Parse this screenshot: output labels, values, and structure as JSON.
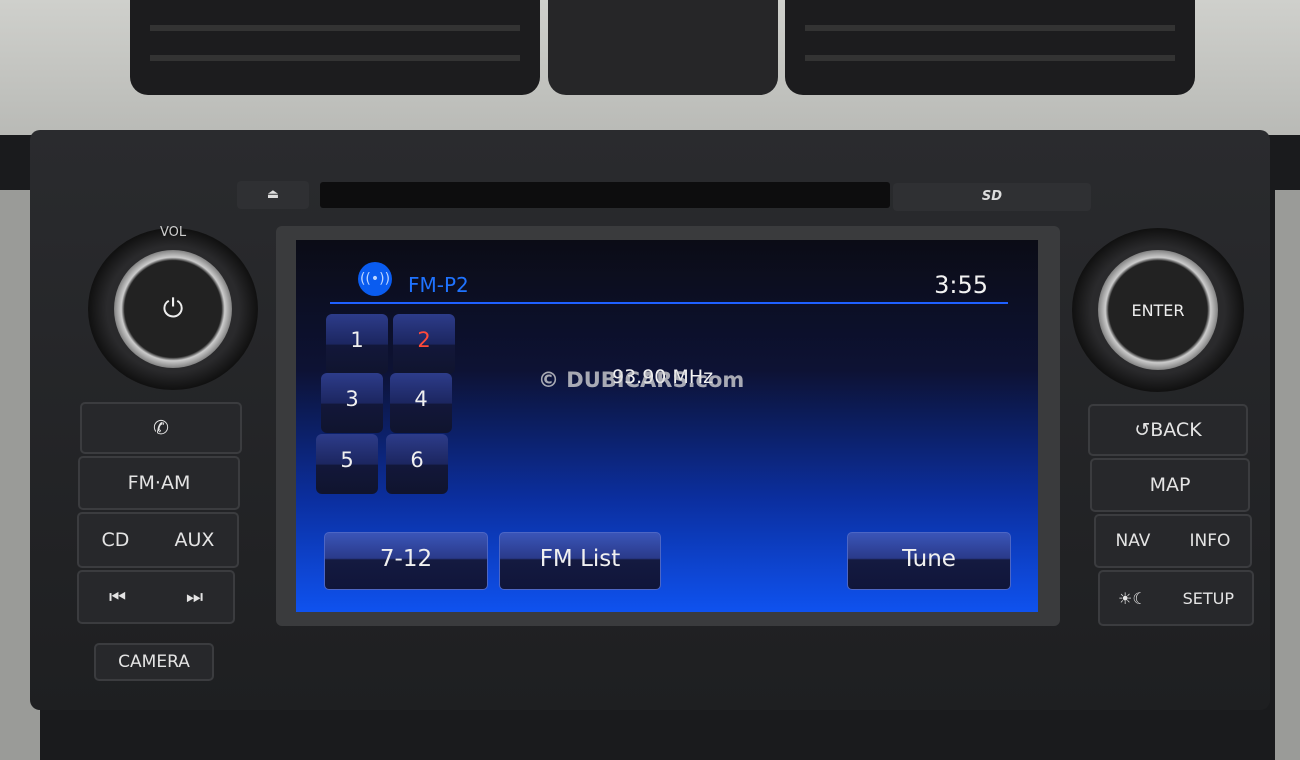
{
  "head_unit": {
    "eject_icon": "eject-icon",
    "sd_label": "SD",
    "vol_label": "VOL",
    "power_icon": "power-icon",
    "enter_label": "ENTER",
    "left_buttons": {
      "phone_icon": "phone-icon",
      "fm_am": "FM·AM",
      "cd": "CD",
      "aux": "AUX",
      "prev_icon": "skip-back-icon",
      "next_icon": "skip-forward-icon",
      "prev": "⏮",
      "next": "⏭",
      "camera": "CAMERA"
    },
    "right_buttons": {
      "back": "BACK",
      "map": "MAP",
      "nav": "NAV",
      "info": "INFO",
      "day_night_icon": "day-night-icon",
      "setup": "SETUP"
    }
  },
  "screen": {
    "source_icon": "radio-signal-icon",
    "band": "FM-P2",
    "time": "3:55",
    "presets": [
      {
        "label": "1",
        "active": false
      },
      {
        "label": "2",
        "active": true
      },
      {
        "label": "3",
        "active": false
      },
      {
        "label": "4",
        "active": false
      },
      {
        "label": "5",
        "active": false
      },
      {
        "label": "6",
        "active": false
      }
    ],
    "frequency": "93.90 MHz",
    "buttons": {
      "more_presets": "7-12",
      "list": "FM List",
      "tune": "Tune"
    },
    "colors": {
      "accent": "#1f73ff",
      "active_preset": "#ff4a3a"
    }
  },
  "watermark": "© DUBICARS.com"
}
